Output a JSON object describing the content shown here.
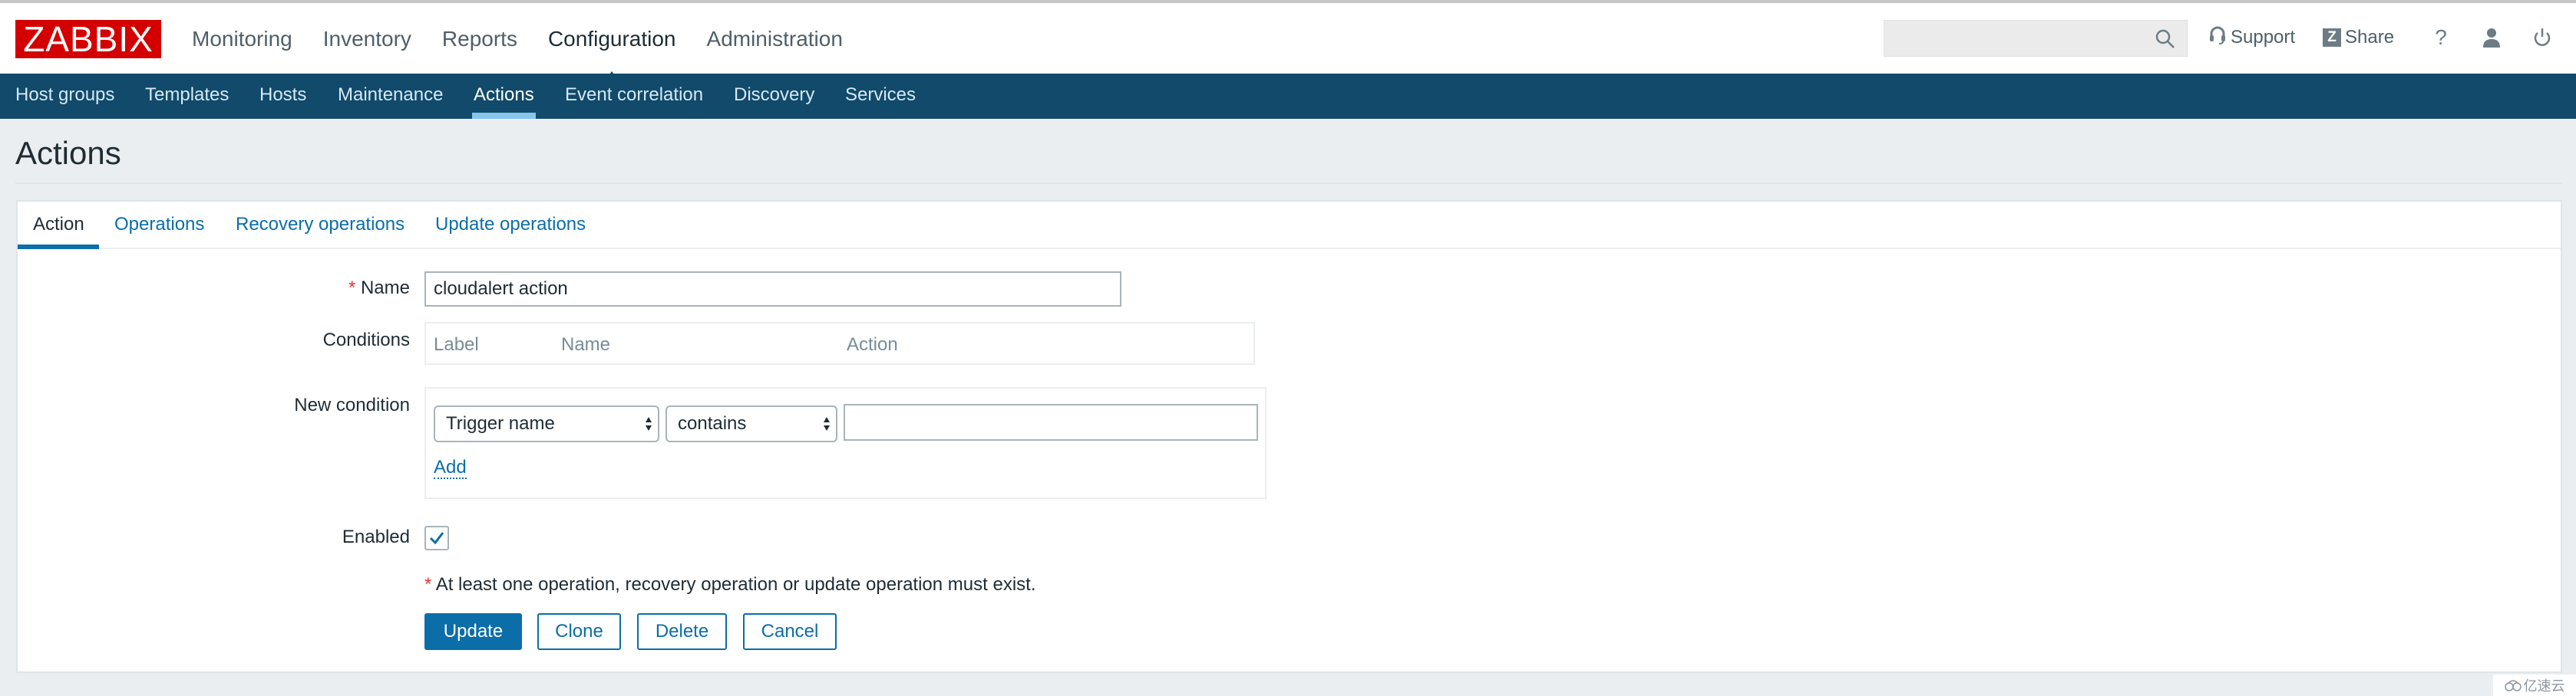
{
  "header": {
    "logo": "ZABBIX",
    "main_menu": [
      {
        "label": "Monitoring",
        "active": false
      },
      {
        "label": "Inventory",
        "active": false
      },
      {
        "label": "Reports",
        "active": false
      },
      {
        "label": "Configuration",
        "active": true
      },
      {
        "label": "Administration",
        "active": false
      }
    ],
    "search": {
      "value": "",
      "placeholder": "",
      "icon": "search-icon"
    },
    "support_label": "Support",
    "share_label": "Share",
    "share_badge": "Z",
    "help_label": "?",
    "icons": [
      "headset-icon",
      "share-z-icon",
      "help-icon",
      "user-icon",
      "power-icon"
    ]
  },
  "subnav": [
    {
      "label": "Host groups",
      "active": false
    },
    {
      "label": "Templates",
      "active": false
    },
    {
      "label": "Hosts",
      "active": false
    },
    {
      "label": "Maintenance",
      "active": false
    },
    {
      "label": "Actions",
      "active": true
    },
    {
      "label": "Event correlation",
      "active": false
    },
    {
      "label": "Discovery",
      "active": false
    },
    {
      "label": "Services",
      "active": false
    }
  ],
  "page_title": "Actions",
  "tabs": [
    {
      "label": "Action",
      "active": true
    },
    {
      "label": "Operations",
      "active": false
    },
    {
      "label": "Recovery operations",
      "active": false
    },
    {
      "label": "Update operations",
      "active": false
    }
  ],
  "form": {
    "name": {
      "required_mark": "*",
      "label": "Name",
      "value": "cloudalert action"
    },
    "conditions": {
      "label": "Conditions",
      "columns": [
        "Label",
        "Name",
        "Action"
      ],
      "rows": []
    },
    "new_condition": {
      "label": "New condition",
      "type_select": "Trigger name",
      "operator_select": "contains",
      "value": "",
      "add_label": "Add"
    },
    "enabled": {
      "label": "Enabled",
      "checked": true
    },
    "note": {
      "required_mark": "*",
      "text": "At least one operation, recovery operation or update operation must exist."
    },
    "buttons": {
      "update": "Update",
      "clone": "Clone",
      "delete": "Delete",
      "cancel": "Cancel"
    }
  },
  "watermark": "亿速云",
  "colors": {
    "brand_red": "#d40000",
    "nav_bg": "#114a6a",
    "nav_active_underline": "#85c5ec",
    "accent_blue": "#0b6ea8",
    "required_red": "#e33734"
  }
}
